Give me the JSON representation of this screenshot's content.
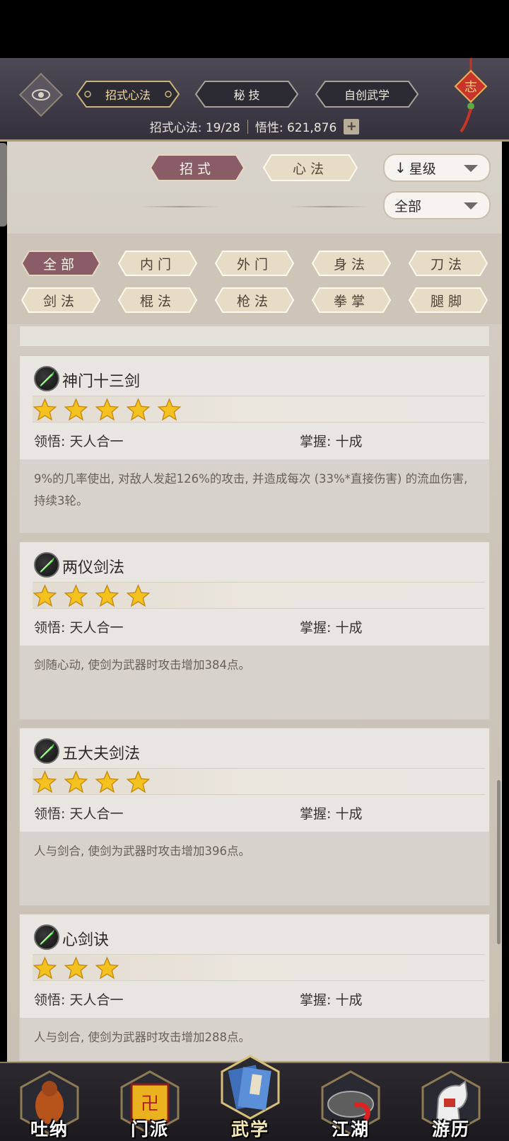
{
  "header": {
    "tabs": [
      {
        "label": "招式心法",
        "active": true
      },
      {
        "label": "秘  技",
        "active": false
      },
      {
        "label": "自创武学",
        "active": false
      }
    ],
    "stats": {
      "progress_label": "招式心法: 19/28",
      "comprehension_label": "悟性: 621,876"
    }
  },
  "toggle": {
    "moves": "招式",
    "methods": "心法",
    "active": "moves"
  },
  "sort_dropdown": {
    "value": "星级"
  },
  "filter_dropdown": {
    "value": "全部"
  },
  "categories": [
    {
      "label": "全部",
      "active": true
    },
    {
      "label": "内门",
      "active": false
    },
    {
      "label": "外门",
      "active": false
    },
    {
      "label": "身法",
      "active": false
    },
    {
      "label": "刀法",
      "active": false
    },
    {
      "label": "剑法",
      "active": false
    },
    {
      "label": "棍法",
      "active": false
    },
    {
      "label": "枪法",
      "active": false
    },
    {
      "label": "拳掌",
      "active": false
    },
    {
      "label": "腿脚",
      "active": false
    }
  ],
  "skills": [
    {
      "name": "神门十三剑",
      "stars": 5,
      "insight": "领悟: 天人合一",
      "mastery": "掌握: 十成",
      "desc": "9%的几率使出, 对敌人发起126%的攻击, 并造成每次 (33%*直接伤害) 的流血伤害, 持续3轮。"
    },
    {
      "name": "两仪剑法",
      "stars": 4,
      "insight": "领悟: 天人合一",
      "mastery": "掌握: 十成",
      "desc": "剑随心动, 使剑为武器时攻击增加384点。"
    },
    {
      "name": "五大夫剑法",
      "stars": 4,
      "insight": "领悟: 天人合一",
      "mastery": "掌握: 十成",
      "desc": "人与剑合, 使剑为武器时攻击增加396点。"
    },
    {
      "name": "心剑诀",
      "stars": 3,
      "insight": "领悟: 天人合一",
      "mastery": "掌握: 十成",
      "desc": "人与剑合, 使剑为武器时攻击增加288点。"
    }
  ],
  "bottom_nav": [
    {
      "label": "吐纳",
      "icon": "monk-icon",
      "active": false
    },
    {
      "label": "门派",
      "icon": "banner-icon",
      "active": false
    },
    {
      "label": "武学",
      "icon": "book-icon",
      "active": true
    },
    {
      "label": "江湖",
      "icon": "hat-icon",
      "active": false
    },
    {
      "label": "游历",
      "icon": "horse-icon",
      "active": false
    }
  ],
  "colors": {
    "active_pill": "#8a5d66",
    "inactive_pill": "#e7dcc6",
    "header_bg": "#3e3b46",
    "star": "#f4c21f"
  }
}
